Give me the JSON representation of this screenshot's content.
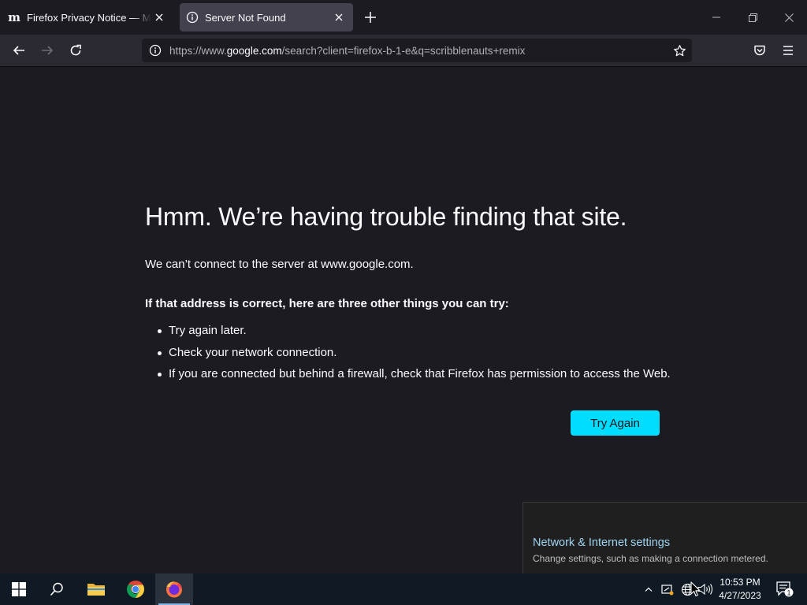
{
  "browser": {
    "tabs": [
      {
        "title": "Firefox Privacy Notice — Mozilla",
        "favicon": "m",
        "active": false
      },
      {
        "title": "Server Not Found",
        "active": true
      }
    ],
    "url": {
      "prefix": "https://www.",
      "host": "google.com",
      "path": "/search?client=firefox-b-1-e&q=scribblenauts+remix"
    }
  },
  "error_page": {
    "title": "Hmm. We’re having trouble finding that site.",
    "description": "We can’t connect to the server at www.google.com.",
    "suggestions_heading": "If that address is correct, here are three other things you can try:",
    "suggestions": [
      "Try again later.",
      "Check your network connection.",
      "If you are connected but behind a firewall, check that Firefox has permission to access the Web."
    ],
    "try_again_label": "Try Again"
  },
  "network_flyout": {
    "title": "Network & Internet settings",
    "subtitle": "Change settings, such as making a connection metered."
  },
  "taskbar": {
    "time": "10:53 PM",
    "date": "4/27/2023",
    "notification_count": "1"
  },
  "colors": {
    "accent": "#00ddff",
    "page_background": "#1c1b22",
    "toolbar": "#2b2a33",
    "taskbar": "#101a24"
  }
}
